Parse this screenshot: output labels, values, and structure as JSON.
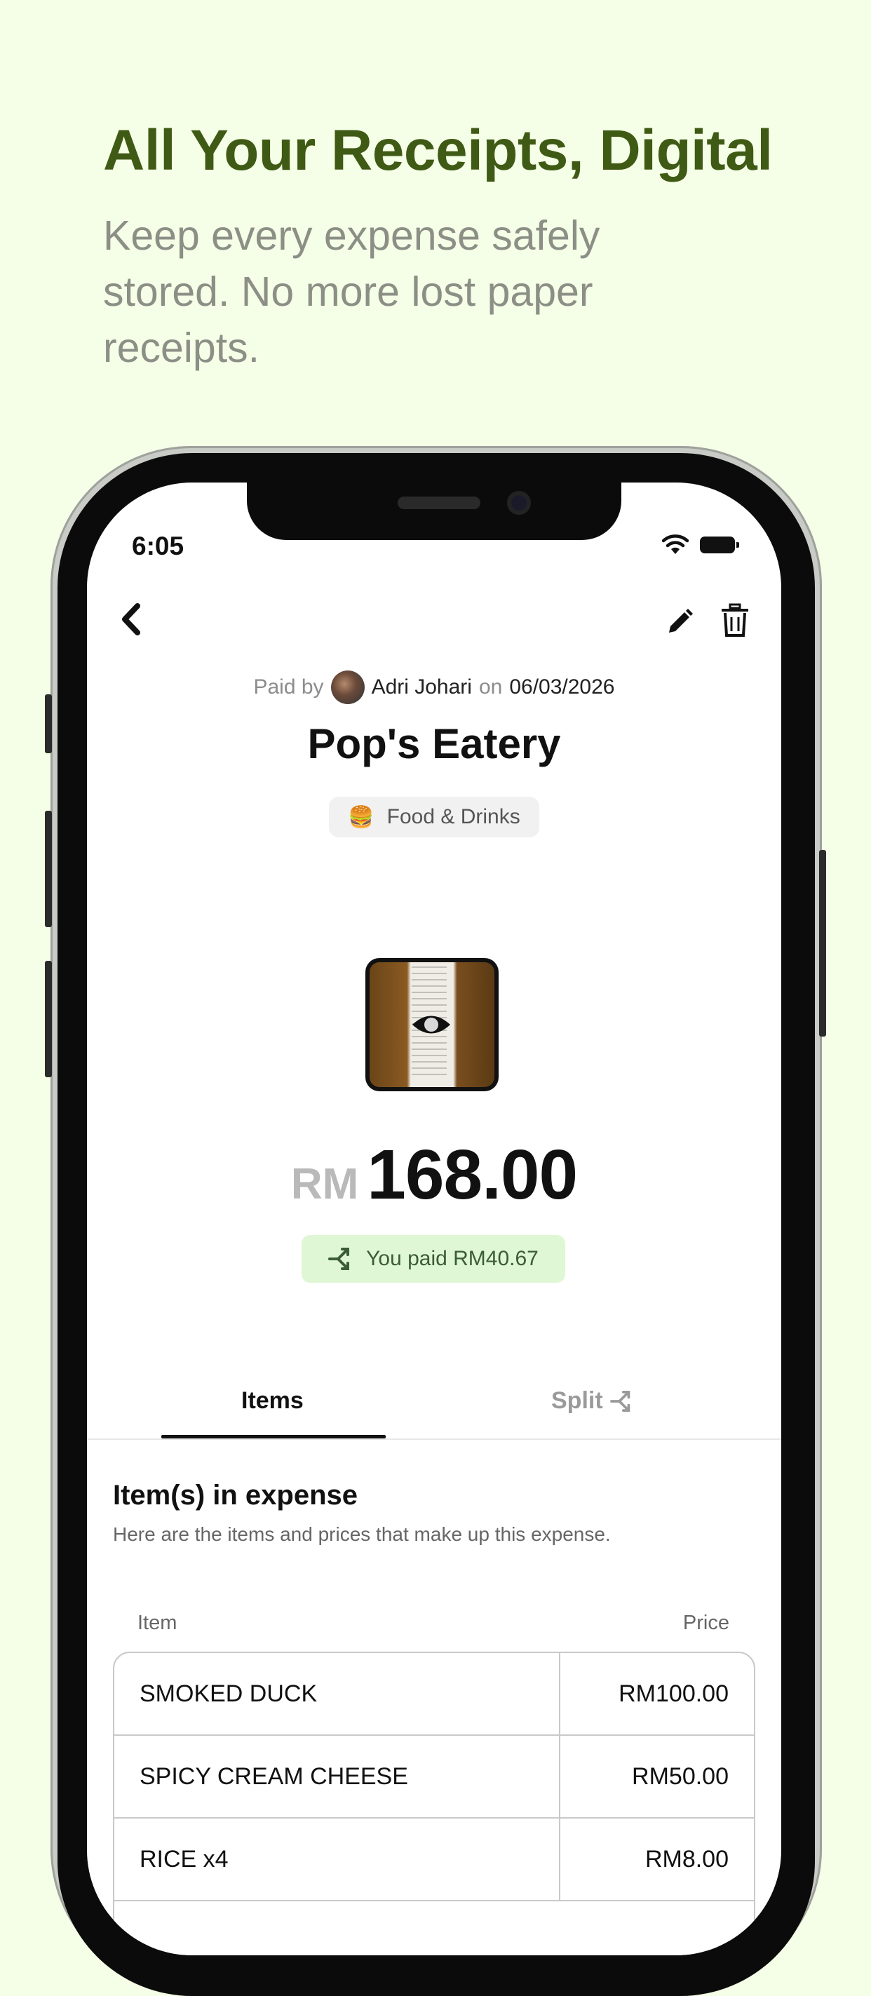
{
  "hero": {
    "title": "All Your Receipts, Digital",
    "subtitle": "Keep every expense safely stored. No more lost paper receipts."
  },
  "status_bar": {
    "time": "6:05"
  },
  "header": {
    "back_icon": "chevron-left-icon",
    "edit_icon": "pencil-icon",
    "delete_icon": "trash-icon"
  },
  "expense": {
    "paid_by_label": "Paid by",
    "payer_name": "Adri Johari",
    "on_label": "on",
    "date": "06/03/2026",
    "merchant": "Pop's Eatery",
    "category_emoji": "🍔",
    "category": "Food & Drinks",
    "currency": "RM",
    "amount": "168.00",
    "you_paid": "You paid RM40.67"
  },
  "tabs": [
    {
      "label": "Items",
      "active": true
    },
    {
      "label": "Split",
      "active": false
    }
  ],
  "items_section": {
    "title": "Item(s) in expense",
    "description": "Here are the items and prices that make up this expense.",
    "col_item": "Item",
    "col_price": "Price",
    "rows": [
      {
        "name": "SMOKED DUCK",
        "price": "RM100.00"
      },
      {
        "name": "SPICY CREAM CHEESE",
        "price": "RM50.00"
      },
      {
        "name": "RICE x4",
        "price": "RM8.00"
      }
    ]
  },
  "colors": {
    "background": "#f5fee6",
    "hero_title": "#3f5a14",
    "you_paid_bg": "#dff7d4"
  }
}
